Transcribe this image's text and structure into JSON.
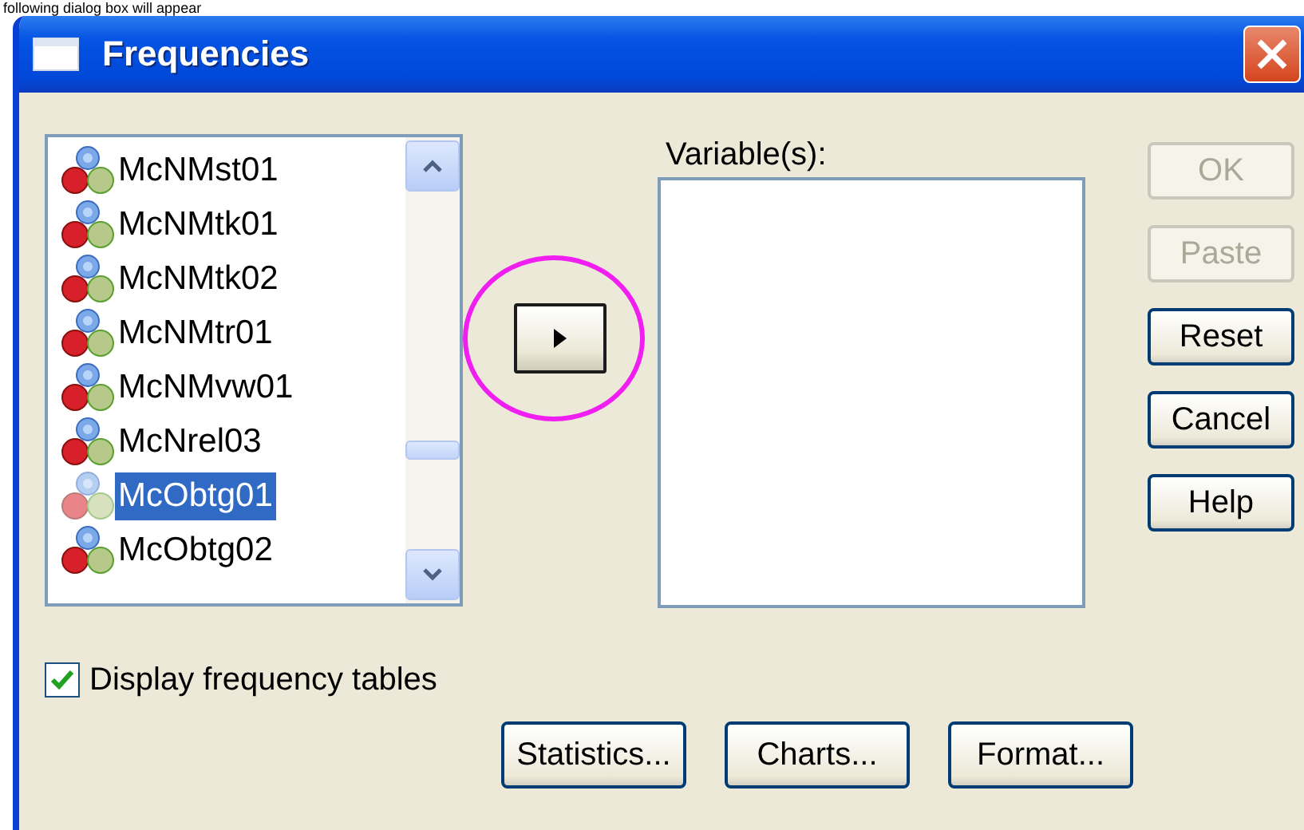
{
  "caption": "following dialog box will appear",
  "window": {
    "title": "Frequencies"
  },
  "source_list": {
    "items": [
      {
        "name": "McNMst01",
        "selected": false
      },
      {
        "name": "McNMtk01",
        "selected": false
      },
      {
        "name": "McNMtk02",
        "selected": false
      },
      {
        "name": "McNMtr01",
        "selected": false
      },
      {
        "name": "McNMvw01",
        "selected": false
      },
      {
        "name": "McNrel03",
        "selected": false
      },
      {
        "name": "McObtg01",
        "selected": true
      },
      {
        "name": "McObtg02",
        "selected": false
      }
    ]
  },
  "move_button": {
    "highlighted": true
  },
  "variables": {
    "label": "Variable(s):"
  },
  "side_buttons": [
    {
      "label": "OK",
      "disabled": true
    },
    {
      "label": "Paste",
      "disabled": true
    },
    {
      "label": "Reset",
      "disabled": false
    },
    {
      "label": "Cancel",
      "disabled": false
    },
    {
      "label": "Help",
      "disabled": false
    }
  ],
  "display_tables": {
    "label": "Display frequency tables",
    "checked": true
  },
  "bottom_buttons": [
    "Statistics...",
    "Charts...",
    "Format..."
  ]
}
